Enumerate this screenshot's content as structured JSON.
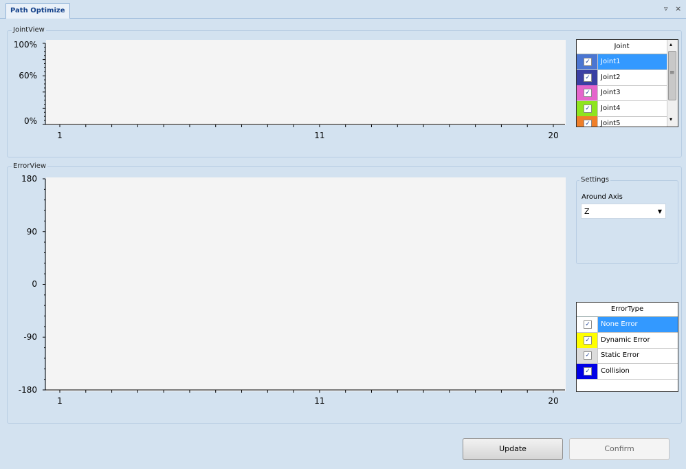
{
  "tab": {
    "title": "Path Optimize",
    "pin_glyph": "▿",
    "close_glyph": "×"
  },
  "joint_view": {
    "title": "JointView",
    "y_ticks": [
      "100%",
      "60%",
      "0%"
    ],
    "x_ticks": [
      "1",
      "11",
      "20"
    ],
    "list_header": "Joint",
    "items": [
      {
        "label": "Joint1",
        "color": "#4b76d2",
        "checked": true,
        "selected": true
      },
      {
        "label": "Joint2",
        "color": "#3a3fa3",
        "checked": true,
        "selected": false
      },
      {
        "label": "Joint3",
        "color": "#e565cc",
        "checked": true,
        "selected": false
      },
      {
        "label": "Joint4",
        "color": "#8ee51f",
        "checked": true,
        "selected": false
      },
      {
        "label": "Joint5",
        "color": "#ef7f2a",
        "checked": true,
        "selected": false
      }
    ],
    "scroll_glyph_up": "▴",
    "scroll_glyph_down": "▾",
    "scroll_grip": "≡"
  },
  "error_view": {
    "title": "ErrorView",
    "y_ticks": [
      "180",
      "90",
      "0",
      "-90",
      "-180"
    ],
    "x_ticks": [
      "1",
      "11",
      "20"
    ],
    "settings": {
      "title": "Settings",
      "label": "Around Axis",
      "axis_value": "Z"
    },
    "list_header": "ErrorType",
    "items": [
      {
        "label": "None Error",
        "color": "#ffffff",
        "checked": true,
        "selected": true
      },
      {
        "label": "Dynamic Error",
        "color": "#ffff00",
        "checked": true,
        "selected": false
      },
      {
        "label": "Static Error",
        "color": "#dcdcdc",
        "checked": true,
        "selected": false
      },
      {
        "label": "Collision",
        "color": "#0000e6",
        "checked": true,
        "selected": false
      }
    ]
  },
  "buttons": {
    "update": "Update",
    "confirm": "Confirm"
  },
  "check_glyph": "✓"
}
